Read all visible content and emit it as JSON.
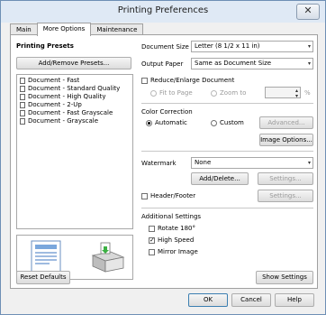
{
  "window": {
    "title": "Printing Preferences",
    "close_label": "✕"
  },
  "tabs": [
    {
      "label": "Main"
    },
    {
      "label": "More Options"
    },
    {
      "label": "Maintenance"
    }
  ],
  "left": {
    "heading": "Printing Presets",
    "add_remove_button": "Add/Remove Presets...",
    "presets": [
      "Document - Fast",
      "Document - Standard Quality",
      "Document - High Quality",
      "Document - 2-Up",
      "Document - Fast Grayscale",
      "Document - Grayscale"
    ]
  },
  "right": {
    "document_size_label": "Document Size",
    "document_size_value": "Letter (8 1/2 x 11 in)",
    "output_paper_label": "Output Paper",
    "output_paper_value": "Same as Document Size",
    "reduce_label": "Reduce/Enlarge Document",
    "fit_to_page_label": "Fit to Page",
    "zoom_to_label": "Zoom to",
    "percent_label": "%",
    "color_correction_label": "Color Correction",
    "automatic_label": "Automatic",
    "custom_label": "Custom",
    "advanced_button": "Advanced...",
    "image_options_button": "Image Options...",
    "watermark_label": "Watermark",
    "watermark_value": "None",
    "add_delete_button": "Add/Delete...",
    "watermark_settings_button": "Settings...",
    "header_footer_label": "Header/Footer",
    "header_settings_button": "Settings...",
    "additional_settings_label": "Additional Settings",
    "rotate_label": "Rotate 180°",
    "high_speed_label": "High Speed",
    "mirror_image_label": "Mirror Image",
    "high_speed_checked": "✓"
  },
  "footer": {
    "reset_defaults_button": "Reset Defaults",
    "show_settings_button": "Show Settings",
    "ok_button": "OK",
    "cancel_button": "Cancel",
    "help_button": "Help"
  },
  "arrows": {
    "down": "▾",
    "up": "▴"
  }
}
